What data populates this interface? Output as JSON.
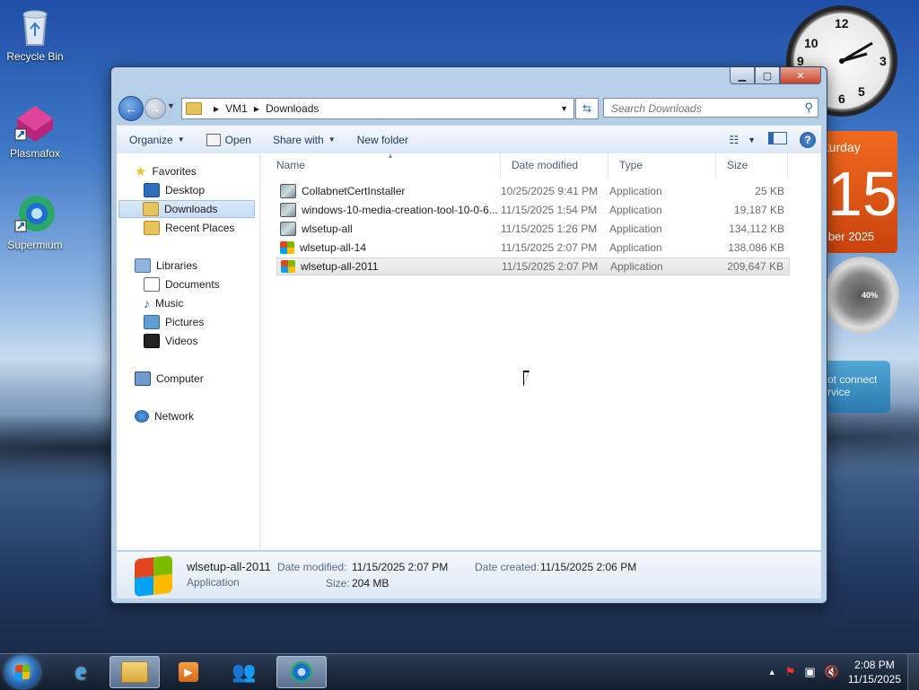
{
  "desktop": {
    "icons": [
      {
        "label": "Recycle Bin"
      },
      {
        "label": "Plasmafox"
      },
      {
        "label": "Supermium"
      }
    ],
    "calendar": {
      "day": "aturday",
      "number": "15",
      "month": "mber 2025"
    },
    "meter": {
      "percent": "40%"
    },
    "weather": {
      "line1": "ot connect",
      "line2": "rvice"
    },
    "clock": {
      "n12": "12",
      "n3": "3",
      "n6": "6",
      "n9": "9",
      "n10": "10",
      "n5": "5"
    }
  },
  "window": {
    "address": {
      "segments": [
        "VM1",
        "Downloads"
      ]
    },
    "search": {
      "placeholder": "Search Downloads"
    },
    "toolbar": {
      "organize": "Organize",
      "open": "Open",
      "share_with": "Share with",
      "new_folder": "New folder"
    },
    "nav": {
      "favorites": "Favorites",
      "desktop": "Desktop",
      "downloads": "Downloads",
      "recent_places": "Recent Places",
      "libraries": "Libraries",
      "documents": "Documents",
      "music": "Music",
      "pictures": "Pictures",
      "videos": "Videos",
      "computer": "Computer",
      "network": "Network"
    },
    "columns": {
      "name": "Name",
      "date_modified": "Date modified",
      "type": "Type",
      "size": "Size"
    },
    "files": [
      {
        "name": "CollabnetCertInstaller",
        "date": "10/25/2025 9:41 PM",
        "type": "Application",
        "size": "25 KB",
        "icon": "app-icon"
      },
      {
        "name": "windows-10-media-creation-tool-10-0-6...",
        "date": "11/15/2025 1:54 PM",
        "type": "Application",
        "size": "19,187 KB",
        "icon": "app-icon"
      },
      {
        "name": "wlsetup-all",
        "date": "11/15/2025 1:26 PM",
        "type": "Application",
        "size": "134,112 KB",
        "icon": "app-icon"
      },
      {
        "name": "wlsetup-all-14",
        "date": "11/15/2025 2:07 PM",
        "type": "Application",
        "size": "138,086 KB",
        "icon": "windows-logo-icon"
      },
      {
        "name": "wlsetup-all-2011",
        "date": "11/15/2025 2:07 PM",
        "type": "Application",
        "size": "209,647 KB",
        "icon": "windows-logo-icon",
        "selected": true
      }
    ],
    "details": {
      "name": "wlsetup-all-2011",
      "type": "Application",
      "date_modified_label": "Date modified:",
      "date_modified": "11/15/2025 2:07 PM",
      "size_label": "Size:",
      "size": "204 MB",
      "date_created_label": "Date created:",
      "date_created": "11/15/2025 2:06 PM"
    }
  },
  "taskbar": {
    "time": "2:08 PM",
    "date": "11/15/2025"
  }
}
